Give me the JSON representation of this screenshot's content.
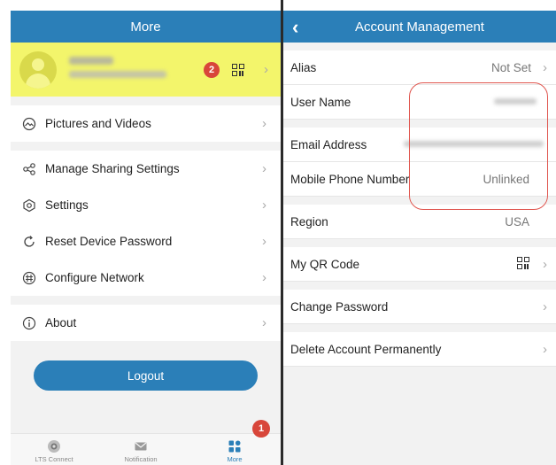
{
  "left": {
    "title": "More",
    "profile": {
      "badge": "2"
    },
    "menu": [
      {
        "label": "Pictures and Videos",
        "icon": "pictures-icon"
      },
      {
        "label": "Manage Sharing Settings",
        "icon": "share-icon"
      },
      {
        "label": "Settings",
        "icon": "settings-icon"
      },
      {
        "label": "Reset Device Password",
        "icon": "reset-icon"
      },
      {
        "label": "Configure Network",
        "icon": "network-icon"
      },
      {
        "label": "About",
        "icon": "info-icon"
      }
    ],
    "logout": "Logout",
    "tabs": [
      {
        "label": "LTS Connect",
        "icon": "camera-icon"
      },
      {
        "label": "Notification",
        "icon": "mail-icon"
      },
      {
        "label": "More",
        "icon": "grid-icon"
      }
    ],
    "tab_badge": "1"
  },
  "right": {
    "title": "Account Management",
    "rows": [
      {
        "label": "Alias",
        "value": "Not Set"
      },
      {
        "label": "User Name",
        "value": ""
      },
      {
        "label": "Email Address",
        "value": ""
      },
      {
        "label": "Mobile Phone Number",
        "value": "Unlinked"
      },
      {
        "label": "Region",
        "value": "USA"
      },
      {
        "label": "My QR Code",
        "value": ""
      },
      {
        "label": "Change Password",
        "value": ""
      },
      {
        "label": "Delete Account Permanently",
        "value": ""
      }
    ]
  },
  "colors": {
    "accent": "#2b7fb8",
    "highlight": "#f3f56b",
    "badge": "#d8463a",
    "annotation": "#e0564f"
  }
}
